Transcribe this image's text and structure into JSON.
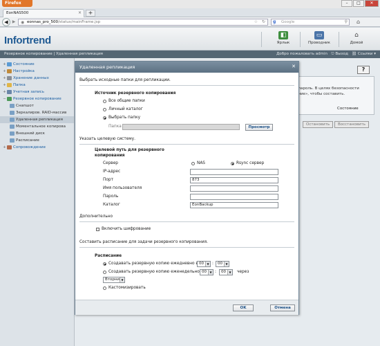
{
  "browser": {
    "menu_label": "Firefox",
    "tab_title": "EonNAS500",
    "url_host": "eonnas_pro_500",
    "url_path": "/status/mainFrame.jsp",
    "search_placeholder": "Google"
  },
  "header": {
    "logo": "Infortrend",
    "buttons": [
      {
        "label": "Ярлык",
        "icon": "shortcut-icon"
      },
      {
        "label": "Проводник",
        "icon": "explorer-icon"
      },
      {
        "label": "Домой",
        "icon": "home-icon"
      }
    ]
  },
  "subbar": {
    "breadcrumb": "Резервное копирование | Удаленная репликация",
    "welcome": "Добро пожаловать admin",
    "logout": "Выход",
    "links": "Ссылки"
  },
  "sidebar": {
    "items": [
      {
        "label": "Состояние",
        "level": 0,
        "expander": "+"
      },
      {
        "label": "Настройка",
        "level": 0,
        "expander": "+"
      },
      {
        "label": "Хранение данных",
        "level": 0,
        "expander": "+"
      },
      {
        "label": "Папка",
        "level": 0,
        "expander": "+"
      },
      {
        "label": "Учетная запись",
        "level": 0,
        "expander": "+"
      },
      {
        "label": "Резервное копирование",
        "level": 0,
        "expander": "−"
      },
      {
        "label": "Снапшот",
        "level": 1
      },
      {
        "label": "Зеркалиров. RAID-массив",
        "level": 1
      },
      {
        "label": "Удаленная репликация",
        "level": 1,
        "selected": true
      },
      {
        "label": "Моментальное копирова",
        "level": 1
      },
      {
        "label": "Внешний диск",
        "level": 1
      },
      {
        "label": "Расписание",
        "level": 1
      },
      {
        "label": "Сопровождение",
        "level": 0,
        "expander": "+"
      }
    ]
  },
  "background": {
    "help": "?",
    "text_line1": ", пароль. В целях безопасности",
    "text_line2": "ение», чтобы составить.",
    "column_header": "Состояние",
    "btn_stop": "Остановить",
    "btn_restore": "Восстановить"
  },
  "modal": {
    "title": "Удаленная репликация",
    "section1": "Выбрать исходные папки для репликации.",
    "source_title": "Источник резервного копирования",
    "opt_all": "Все общие папки",
    "opt_personal": "Личный каталог",
    "opt_select": "Выбрать папку",
    "folder_label": "Папка",
    "folder_value": "",
    "browse": "Просмотр",
    "section2": "Указать целевую систему.",
    "target_title_1": "Целевой путь для резервного",
    "target_title_2": "копирования",
    "server_label": "Сервер",
    "opt_nas": "NAS",
    "opt_rsync": "Rsync сервер",
    "ip_label": "IP-адрес",
    "ip_value": "",
    "port_label": "Порт",
    "port_value": "873",
    "user_label": "Имя пользователя",
    "user_value": "",
    "pass_label": "Пароль",
    "pass_value": "",
    "catalog_label": "Каталог",
    "catalog_value": "EonBackup",
    "section3": "Дополнительно",
    "encrypt_label": "Включить шифрование",
    "section4": "Составить расписание для задачи резервного копирования.",
    "schedule_title": "Расписание",
    "daily_label": "Создавать резервную копию ежедневно в",
    "daily_hour": "00",
    "daily_min": "00",
    "weekly_label": "Создавать резервную копию еженедельно в",
    "weekly_hour": "00",
    "weekly_min": "00",
    "weekly_suffix": "через",
    "weekday": "Вторник",
    "custom_label": "Кастомизировать",
    "ok": "OK",
    "cancel": "Отмена"
  }
}
